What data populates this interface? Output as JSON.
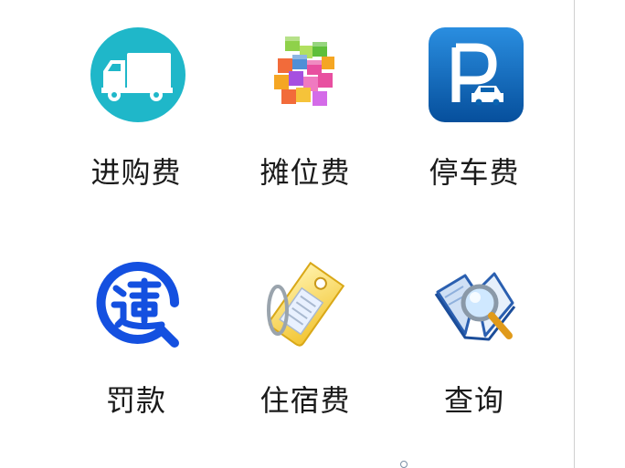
{
  "tiles": [
    {
      "label": "进购费",
      "icon": "truck-icon",
      "color": "#20b8c8"
    },
    {
      "label": "摊位费",
      "icon": "cubes-icon",
      "color": "#e84fa0"
    },
    {
      "label": "停车费",
      "icon": "parking-icon",
      "color": "#0a63b0"
    },
    {
      "label": "罚款",
      "icon": "violation-icon",
      "color": "#1450e0"
    },
    {
      "label": "住宿费",
      "icon": "tag-icon",
      "color": "#f5d24a"
    },
    {
      "label": "查询",
      "icon": "magnifier-book-icon",
      "color": "#2a6fd0"
    }
  ]
}
